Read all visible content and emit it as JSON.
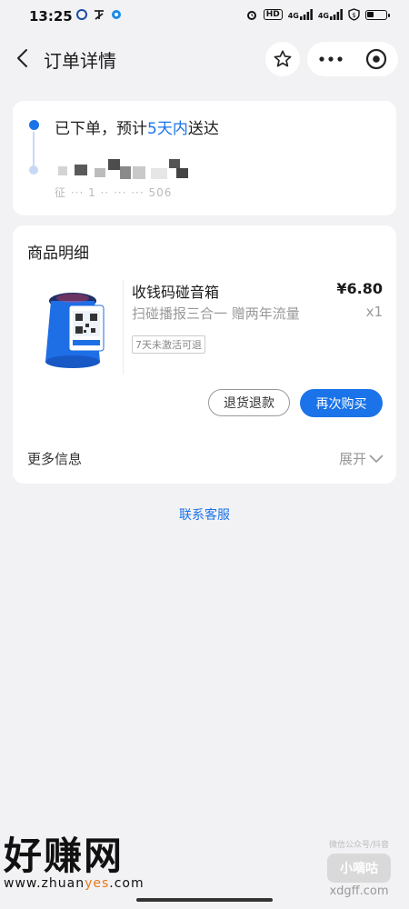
{
  "status_bar": {
    "time": "13:25",
    "left_icons": [
      "notification-app-icon",
      "notification-app-icon",
      "notification-app-icon"
    ],
    "right_icons": [
      "alarm-icon",
      "hd-icon",
      "signal-icon",
      "signal-icon",
      "vpn-icon",
      "battery-icon"
    ],
    "hd_label": "HD",
    "signal1": "4G",
    "signal2": "4G",
    "battery_level": 0.35
  },
  "nav": {
    "title": "订单详情"
  },
  "order_status": {
    "text_before": "已下单，预计",
    "text_highlight": "5天内",
    "text_after": "送达",
    "address_partial": "征 ··· 1 ·· ··· ··· 506",
    "accent_color": "#1a73e8"
  },
  "goods": {
    "section_title": "商品明细",
    "name": "收钱码碰音箱",
    "price": "¥6.80",
    "desc": "扫碰播报三合一  赠两年流量",
    "qty": "x1",
    "tag": "7天未激活可退",
    "refund_label": "退货退款",
    "rebuy_label": "再次购买",
    "more_label": "更多信息",
    "expand_label": "展开"
  },
  "contact_label": "联系客服",
  "watermark": {
    "left_big": "好赚网",
    "left_url_a": "www.zhuan",
    "left_url_b": "yes",
    "left_url_c": ".com",
    "right_small": "微信公众号/抖音",
    "right_brand": "小嘀咕",
    "right_domain": "xdgff.com"
  }
}
